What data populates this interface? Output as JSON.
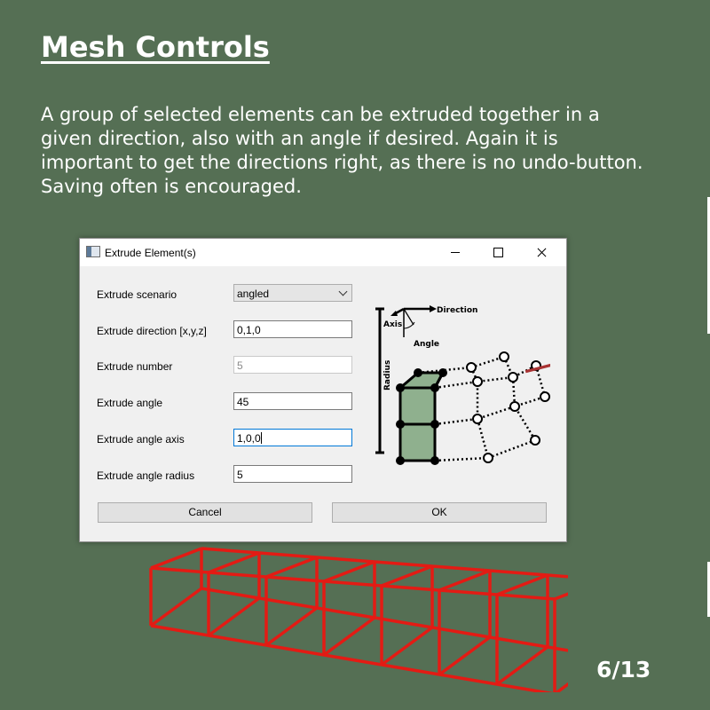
{
  "slide": {
    "title": "Mesh Controls",
    "body": "A group of selected elements can be extruded together in a given direction, also with an angle if desired. Again it is important to get the directions right, as there is no undo-button. Saving often is encouraged.",
    "page_number": "6/13",
    "background_color": "#556f54"
  },
  "dialog": {
    "title": "Extrude Element(s)",
    "window_controls": [
      "minimize-icon",
      "maximize-icon",
      "close-icon"
    ],
    "fields": {
      "scenario": {
        "label": "Extrude scenario",
        "value": "angled"
      },
      "direction": {
        "label": "Extrude direction [x,y,z]",
        "value": "0,1,0"
      },
      "number": {
        "label": "Extrude number",
        "value": "5"
      },
      "angle": {
        "label": "Extrude angle",
        "value": "45"
      },
      "angle_axis": {
        "label": "Extrude angle axis",
        "value": "1,0,0"
      },
      "angle_radius": {
        "label": "Extrude angle radius",
        "value": "5"
      }
    },
    "buttons": {
      "cancel": "Cancel",
      "ok": "OK"
    },
    "diagram": {
      "labels": {
        "direction": "Direction",
        "axis": "Axis",
        "angle": "Angle",
        "radius": "Radius"
      },
      "colors": {
        "element_fill": "#8fb08e",
        "arrow": "#a83232"
      }
    }
  },
  "wireframe": {
    "color": "#e31b14"
  }
}
